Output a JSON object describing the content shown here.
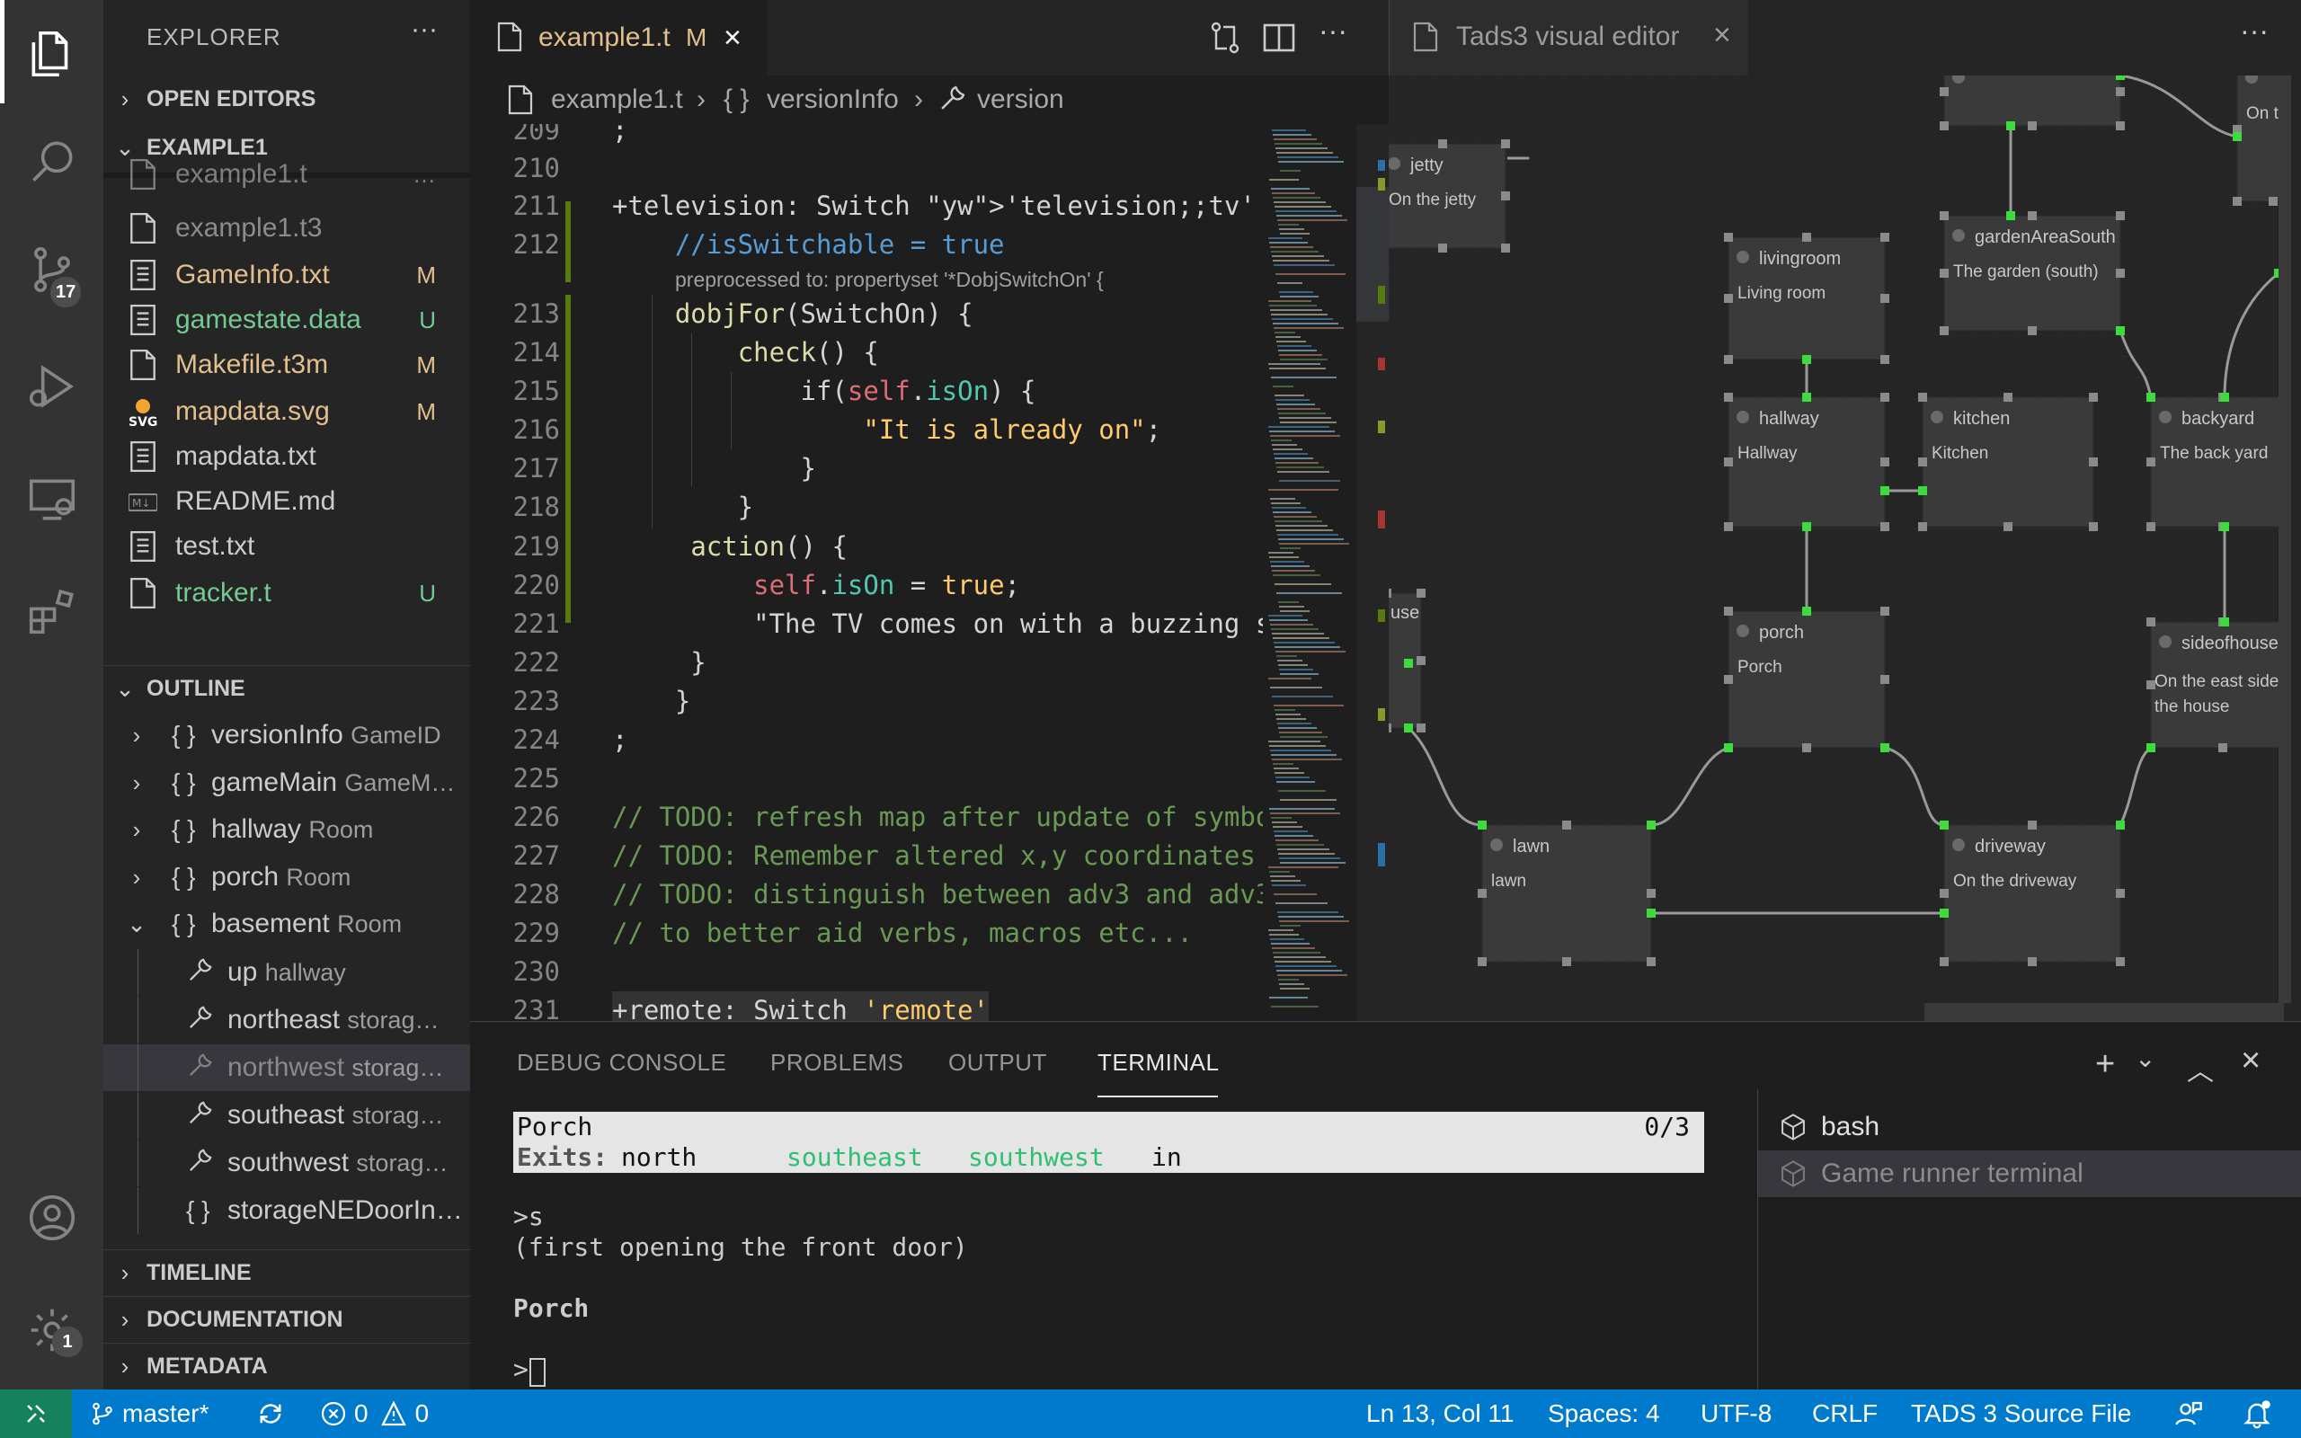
{
  "activity_bar": {
    "scm_badge": "17",
    "settings_badge": "1"
  },
  "sidebar": {
    "title": "EXPLORER",
    "more": "···",
    "open_editors": "OPEN EDITORS",
    "workspace": "EXAMPLE1",
    "files": [
      {
        "name": "example1.t",
        "status": "…",
        "color": "#cccccc",
        "icon": "file-icon"
      },
      {
        "name": "example1.t3",
        "status": "",
        "color": "#8c8c8c",
        "icon": "file-icon"
      },
      {
        "name": "GameInfo.txt",
        "status": "M",
        "color": "#e2c08d",
        "icon": "text-file-icon"
      },
      {
        "name": "gamestate.data",
        "status": "U",
        "color": "#73c991",
        "icon": "text-file-icon"
      },
      {
        "name": "Makefile.t3m",
        "status": "M",
        "color": "#e2c08d",
        "icon": "file-icon"
      },
      {
        "name": "mapdata.svg",
        "status": "M",
        "color": "#e2c08d",
        "icon": "svg-file-icon"
      },
      {
        "name": "mapdata.txt",
        "status": "",
        "color": "#cccccc",
        "icon": "text-file-icon"
      },
      {
        "name": "README.md",
        "status": "",
        "color": "#cccccc",
        "icon": "markdown-file-icon"
      },
      {
        "name": "test.txt",
        "status": "",
        "color": "#cccccc",
        "icon": "text-file-icon"
      },
      {
        "name": "tracker.t",
        "status": "U",
        "color": "#73c991",
        "icon": "file-icon"
      }
    ],
    "outline_title": "OUTLINE",
    "outline": [
      {
        "label": "versionInfo",
        "desc": "GameID",
        "kind": "object",
        "chevron": "›",
        "depth": 0
      },
      {
        "label": "gameMain",
        "desc": "GameM…",
        "kind": "object",
        "chevron": "›",
        "depth": 0
      },
      {
        "label": "hallway",
        "desc": "Room",
        "kind": "object",
        "chevron": "›",
        "depth": 0
      },
      {
        "label": "porch",
        "desc": "Room",
        "kind": "object",
        "chevron": "›",
        "depth": 0
      },
      {
        "label": "basement",
        "desc": "Room",
        "kind": "object",
        "chevron": "⌄",
        "depth": 0
      },
      {
        "label": "up",
        "desc": "hallway",
        "kind": "property",
        "chevron": "",
        "depth": 1
      },
      {
        "label": "northeast",
        "desc": "storag…",
        "kind": "property",
        "chevron": "",
        "depth": 1
      },
      {
        "label": "northwest",
        "desc": "storag…",
        "kind": "property",
        "chevron": "",
        "depth": 1
      },
      {
        "label": "southeast",
        "desc": "storag…",
        "kind": "property",
        "chevron": "",
        "depth": 1
      },
      {
        "label": "southwest",
        "desc": "storag…",
        "kind": "property",
        "chevron": "",
        "depth": 1
      },
      {
        "label": "storageNEDoorIn…",
        "desc": "",
        "kind": "object",
        "chevron": "",
        "depth": 1
      }
    ],
    "timeline": "TIMELINE",
    "documentation": "DOCUMENTATION",
    "metadata": "METADATA"
  },
  "editor": {
    "tab_label": "example1.t",
    "tab_status": "M",
    "breadcrumb": [
      "example1.t",
      "versionInfo",
      "version"
    ],
    "lines": [
      {
        "n": "209",
        "t": ";"
      },
      {
        "n": "210",
        "t": ""
      },
      {
        "n": "211",
        "t": "+television: Switch 'television;;tv'"
      },
      {
        "n": "212",
        "t": "    //isSwitchable = true"
      },
      {
        "n": "",
        "t": "preprocessed to: propertyset '*DobjSwitchOn' {"
      },
      {
        "n": "213",
        "t": "    dobjFor(SwitchOn) {"
      },
      {
        "n": "214",
        "t": "        check() {"
      },
      {
        "n": "215",
        "t": "            if(self.isOn) {"
      },
      {
        "n": "216",
        "t": "                \"It is already on\";"
      },
      {
        "n": "217",
        "t": "            }"
      },
      {
        "n": "218",
        "t": "        }"
      },
      {
        "n": "219",
        "t": "     action() {"
      },
      {
        "n": "220",
        "t": "         self.isOn = true;"
      },
      {
        "n": "221",
        "t": "         \"The TV comes on with a buzzing s"
      },
      {
        "n": "222",
        "t": "     }"
      },
      {
        "n": "223",
        "t": "    }"
      },
      {
        "n": "224",
        "t": ";"
      },
      {
        "n": "225",
        "t": ""
      },
      {
        "n": "226",
        "t": "// TODO: refresh map after update of symbo"
      },
      {
        "n": "227",
        "t": "// TODO: Remember altered x,y coordinates"
      },
      {
        "n": "228",
        "t": "// TODO: distinguish between adv3 and adv3"
      },
      {
        "n": "229",
        "t": "// to better aid verbs, macros etc..."
      },
      {
        "n": "230",
        "t": ""
      },
      {
        "n": "231",
        "t": "+remote: Switch 'remote'"
      }
    ]
  },
  "visual_editor": {
    "tab_label": "Tads3 visual editor",
    "rooms": [
      {
        "id": "jetty",
        "desc": "On the jetty"
      },
      {
        "id": "livingroom",
        "desc": "Living room"
      },
      {
        "id": "gardenAreaSouth",
        "desc": "The garden (south)"
      },
      {
        "id": "hallway",
        "desc": "Hallway"
      },
      {
        "id": "kitchen",
        "desc": "Kitchen"
      },
      {
        "id": "backyard",
        "desc": "The back yard"
      },
      {
        "id": "porch",
        "desc": "Porch"
      },
      {
        "id": "sideofhouse",
        "desc": "On the east side of the house"
      },
      {
        "id": "lawn",
        "desc": "lawn"
      },
      {
        "id": "driveway",
        "desc": "On the driveway"
      },
      {
        "id": "use",
        "desc": ""
      },
      {
        "id": "top",
        "desc": ""
      },
      {
        "id": "topright",
        "desc": "On th"
      }
    ]
  },
  "panel": {
    "tabs": [
      "DEBUG CONSOLE",
      "PROBLEMS",
      "OUTPUT",
      "TERMINAL"
    ],
    "active_tab": "TERMINAL",
    "status_line": {
      "room": "Porch",
      "score": "0/3",
      "exits_label": "Exits:",
      "exits": [
        "north",
        "southeast",
        "southwest",
        "in"
      ]
    },
    "output": [
      ">s",
      "(first opening the front door)",
      "",
      "Porch",
      "",
      ">"
    ],
    "terminals": [
      {
        "name": "bash",
        "active": false
      },
      {
        "name": "Game runner terminal",
        "active": true
      }
    ]
  },
  "statusbar": {
    "branch": "master*",
    "errors": "0",
    "warnings": "0",
    "position": "Ln 13, Col 11",
    "spaces": "Spaces: 4",
    "encoding": "UTF-8",
    "eol": "CRLF",
    "language": "TADS 3 Source File"
  }
}
